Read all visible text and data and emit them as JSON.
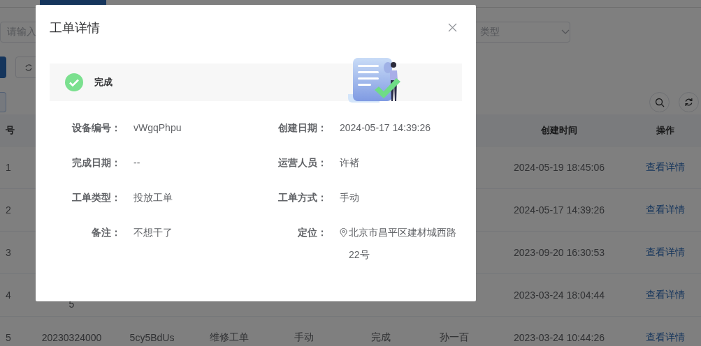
{
  "page": {
    "search": {
      "placeholder": "请输入"
    },
    "type_select": {
      "placeholder": "类型"
    },
    "table": {
      "header": {
        "index": "号",
        "created": "创建时间",
        "action": "操作"
      },
      "rows": [
        {
          "index": "1",
          "created": "2024-05-19 18:45:06",
          "action": "查看详情"
        },
        {
          "index": "2",
          "created": "2024-05-17 14:39:26",
          "action": "查看详情"
        },
        {
          "index": "3",
          "created": "2023-09-20 16:30:53",
          "action": "查看详情"
        },
        {
          "index": "4",
          "order_no": "5",
          "created": "2023-03-24 18:04:44",
          "action": "查看详情"
        },
        {
          "index": "5",
          "order_no": "20230324000",
          "device": "5cy5BdUs",
          "type": "维修工单",
          "method": "手动",
          "status": "完成",
          "operator": "孙一百",
          "created": "2023-03-24 10:44:26",
          "action": "查看详情"
        }
      ]
    }
  },
  "modal": {
    "title": "工单详情",
    "status": {
      "label": "完成"
    },
    "fields": [
      {
        "kind": "text",
        "label": "设备编号：",
        "value": "vWgqPhpu"
      },
      {
        "kind": "text",
        "label": "创建日期：",
        "value": "2024-05-17 14:39:26"
      },
      {
        "kind": "text",
        "label": "完成日期：",
        "value": "--"
      },
      {
        "kind": "text",
        "label": "运营人员：",
        "value": "许褚"
      },
      {
        "kind": "text",
        "label": "工单类型：",
        "value": "投放工单"
      },
      {
        "kind": "text",
        "label": "工单方式：",
        "value": "手动"
      },
      {
        "kind": "text",
        "label": "备注：",
        "value": "不想干了"
      },
      {
        "kind": "location",
        "label": "定位：",
        "value": "北京市昌平区建材城西路22号"
      }
    ]
  }
}
